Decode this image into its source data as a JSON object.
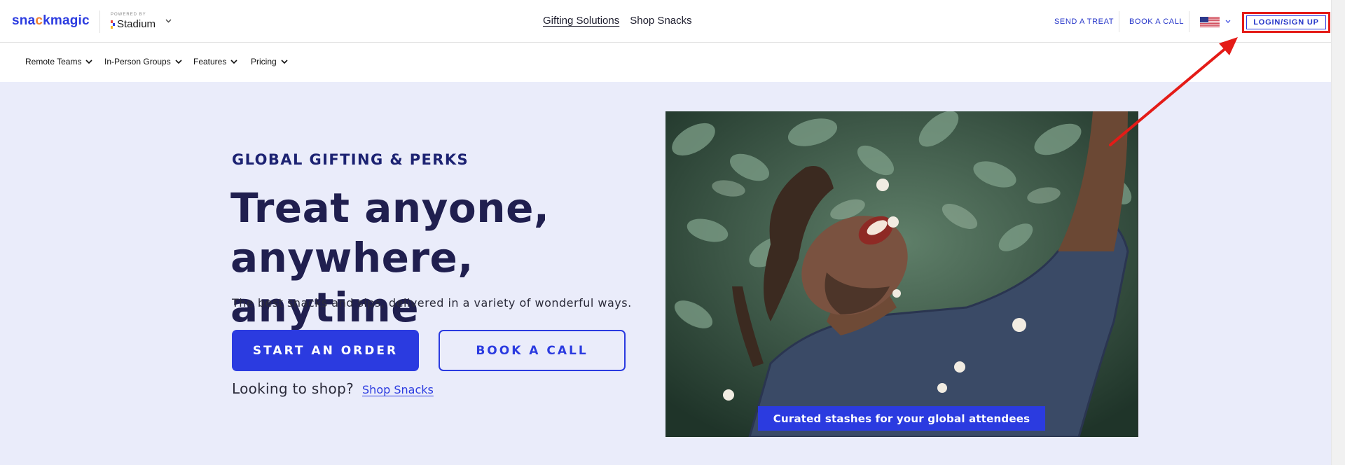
{
  "brand": {
    "logo_pre": "sna",
    "logo_dot": "c",
    "logo_post": "kmagic",
    "powered_label": "POWERED BY",
    "partner": "Stadium"
  },
  "topnav": {
    "center_links": [
      "Gifting Solutions",
      "Shop Snacks"
    ],
    "send_treat": "SEND A TREAT",
    "book_call": "BOOK A CALL",
    "login": "LOGIN/SIGN UP"
  },
  "subnav": {
    "items": [
      "Remote Teams",
      "In-Person Groups",
      "Features",
      "Pricing"
    ]
  },
  "hero": {
    "eyebrow": "GLOBAL GIFTING & PERKS",
    "headline": "Treat anyone, anywhere, anytime",
    "subcopy": "The best snacks and sips, delivered in a variety of wonderful ways.",
    "primary_cta": "START AN ORDER",
    "secondary_cta": "BOOK A CALL",
    "shop_question": "Looking to shop?",
    "shop_link": "Shop Snacks",
    "image_caption": "Curated stashes for your global attendees"
  },
  "colors": {
    "brand_blue": "#2b3be0",
    "hero_bg": "#eaecfa",
    "headline": "#201f4f",
    "annotation_red": "#e41b17"
  }
}
